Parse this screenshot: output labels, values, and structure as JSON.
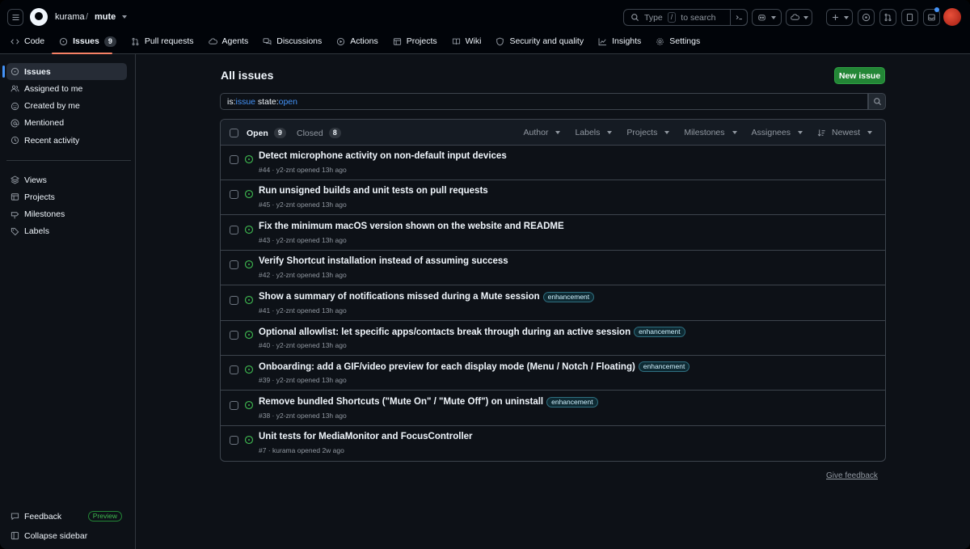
{
  "repo": {
    "owner": "kurama",
    "separator": "/",
    "name": "mute"
  },
  "search": {
    "prefix": "Type",
    "key": "/",
    "suffix": "to search"
  },
  "nav": {
    "tabs": [
      {
        "label": "Code",
        "icon": "code-icon"
      },
      {
        "label": "Issues",
        "icon": "issue-opened-icon",
        "count": "9"
      },
      {
        "label": "Pull requests",
        "icon": "git-pull-request-icon"
      },
      {
        "label": "Agents",
        "icon": "agent-icon"
      },
      {
        "label": "Discussions",
        "icon": "comment-discussion-icon"
      },
      {
        "label": "Actions",
        "icon": "play-icon"
      },
      {
        "label": "Projects",
        "icon": "table-icon"
      },
      {
        "label": "Wiki",
        "icon": "book-icon"
      },
      {
        "label": "Security and quality",
        "icon": "shield-icon"
      },
      {
        "label": "Insights",
        "icon": "graph-icon"
      },
      {
        "label": "Settings",
        "icon": "gear-icon"
      }
    ]
  },
  "sidebar": {
    "items": [
      {
        "label": "Issues",
        "icon": "issue-opened-icon"
      },
      {
        "label": "Assigned to me",
        "icon": "people-icon"
      },
      {
        "label": "Created by me",
        "icon": "smiley-icon"
      },
      {
        "label": "Mentioned",
        "icon": "mention-icon"
      },
      {
        "label": "Recent activity",
        "icon": "clock-icon"
      }
    ],
    "views": [
      {
        "label": "Views",
        "icon": "stack-icon"
      },
      {
        "label": "Projects",
        "icon": "table-icon"
      },
      {
        "label": "Milestones",
        "icon": "milestone-icon"
      },
      {
        "label": "Labels",
        "icon": "tag-icon"
      }
    ],
    "feedback": "Feedback",
    "preview": "Preview",
    "collapse": "Collapse sidebar"
  },
  "main": {
    "title": "All issues",
    "new_issue": "New issue",
    "query": {
      "k1": "is:",
      "v1": "issue",
      "k2": " state:",
      "v2": "open"
    },
    "open_label": "Open",
    "open_count": "9",
    "closed_label": "Closed",
    "closed_count": "8",
    "filters": [
      "Author",
      "Labels",
      "Projects",
      "Milestones",
      "Assignees"
    ],
    "sort": "Newest",
    "give_feedback": "Give feedback"
  },
  "issues": [
    {
      "title": "Detect microphone activity on non-default input devices",
      "meta": "#44 · y2-znt opened 13h ago",
      "label": ""
    },
    {
      "title": "Run unsigned builds and unit tests on pull requests",
      "meta": "#45 · y2-znt opened 13h ago",
      "label": ""
    },
    {
      "title": "Fix the minimum macOS version shown on the website and README",
      "meta": "#43 · y2-znt opened 13h ago",
      "label": ""
    },
    {
      "title": "Verify Shortcut installation instead of assuming success",
      "meta": "#42 · y2-znt opened 13h ago",
      "label": ""
    },
    {
      "title": "Show a summary of notifications missed during a Mute session",
      "meta": "#41 · y2-znt opened 13h ago",
      "label": "enhancement"
    },
    {
      "title": "Optional allowlist: let specific apps/contacts break through during an active session",
      "meta": "#40 · y2-znt opened 13h ago",
      "label": "enhancement"
    },
    {
      "title": "Onboarding: add a GIF/video preview for each display mode (Menu / Notch / Floating)",
      "meta": "#39 · y2-znt opened 13h ago",
      "label": "enhancement"
    },
    {
      "title": "Remove bundled Shortcuts (\"Mute On\" / \"Mute Off\") on uninstall",
      "meta": "#38 · y2-znt opened 13h ago",
      "label": "enhancement"
    },
    {
      "title": "Unit tests for MediaMonitor and FocusController",
      "meta": "#7 · kurama opened 2w ago",
      "label": ""
    }
  ]
}
